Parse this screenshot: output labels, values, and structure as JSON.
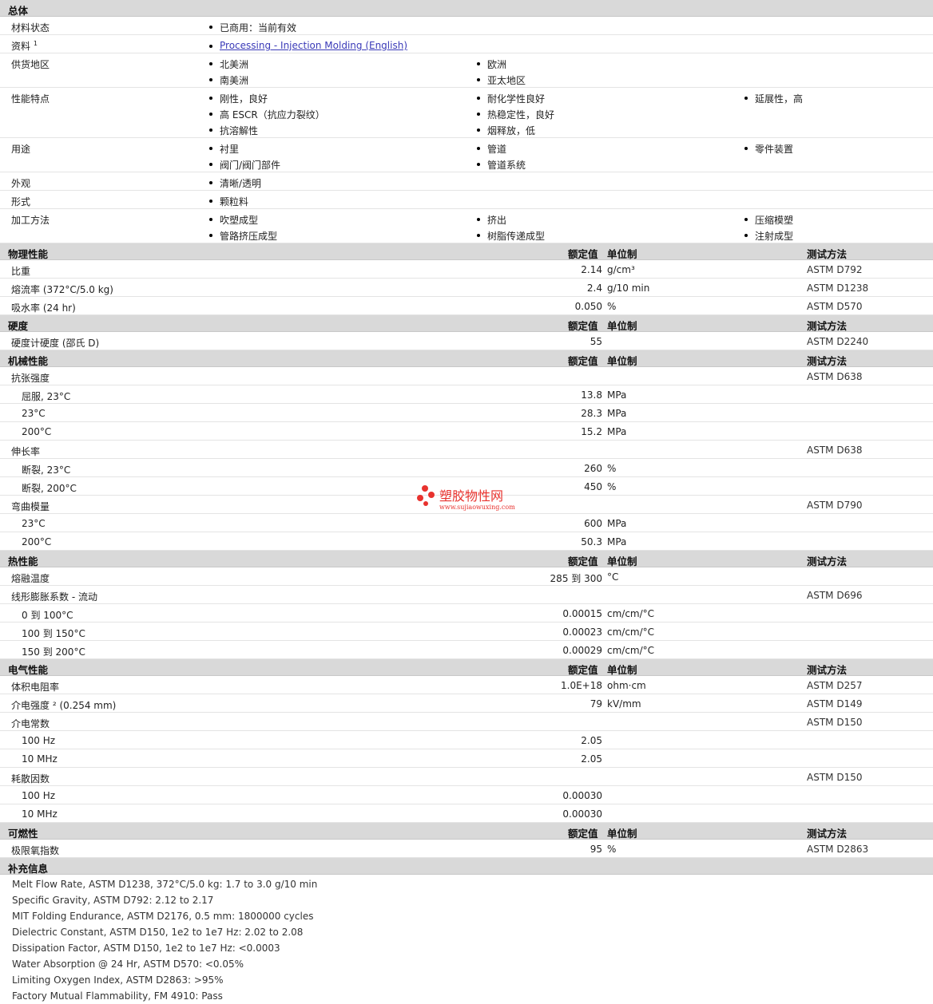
{
  "general": {
    "title": "总体",
    "status_label": "材料状态",
    "status_value": "已商用：当前有效",
    "docs_label": "资料",
    "docs_sup": "1",
    "docs_link": "Processing - Injection Molding (English)",
    "regions_label": "供货地区",
    "regions": [
      "北美洲",
      "欧洲",
      "南美洲",
      "亚太地区"
    ],
    "features_label": "性能特点",
    "features": [
      "刚性，良好",
      "耐化学性良好",
      "延展性，高",
      "高 ESCR（抗应力裂纹）",
      "热稳定性，良好",
      "抗溶解性",
      "烟释放，低"
    ],
    "uses_label": "用途",
    "uses": [
      "衬里",
      "管道",
      "零件装置",
      "阀门/阀门部件",
      "管道系统"
    ],
    "appearance_label": "外观",
    "appearance": "清晰/透明",
    "form_label": "形式",
    "form": "颗粒料",
    "process_label": "加工方法",
    "process": [
      "吹塑成型",
      "挤出",
      "压缩模塑",
      "管路挤压成型",
      "树脂传递成型",
      "注射成型"
    ]
  },
  "headers": {
    "value": "额定值",
    "unit": "单位制",
    "method": "测试方法"
  },
  "sections": [
    {
      "title": "物理性能",
      "rows": [
        {
          "label": "比重",
          "value": "2.14",
          "unit": "g/cm³",
          "method": "ASTM D792"
        },
        {
          "label": "熔流率 (372°C/5.0 kg)",
          "value": "2.4",
          "unit": "g/10 min",
          "method": "ASTM D1238"
        },
        {
          "label": "吸水率 (24 hr)",
          "value": "0.050",
          "unit": "%",
          "method": "ASTM D570"
        }
      ]
    },
    {
      "title": "硬度",
      "rows": [
        {
          "label": "硬度计硬度 (邵氏 D)",
          "value": "55",
          "unit": "",
          "method": "ASTM D2240"
        }
      ]
    },
    {
      "title": "机械性能",
      "rows": [
        {
          "label": "抗张强度",
          "value": "",
          "unit": "",
          "method": "ASTM D638"
        },
        {
          "label": "屈服, 23°C",
          "value": "13.8",
          "unit": "MPa",
          "method": "",
          "sub": true
        },
        {
          "label": "23°C",
          "value": "28.3",
          "unit": "MPa",
          "method": "",
          "sub": true
        },
        {
          "label": "200°C",
          "value": "15.2",
          "unit": "MPa",
          "method": "",
          "sub": true
        },
        {
          "label": "伸长率",
          "value": "",
          "unit": "",
          "method": "ASTM D638"
        },
        {
          "label": "断裂, 23°C",
          "value": "260",
          "unit": "%",
          "method": "",
          "sub": true
        },
        {
          "label": "断裂, 200°C",
          "value": "450",
          "unit": "%",
          "method": "",
          "sub": true
        },
        {
          "label": "弯曲模量",
          "value": "",
          "unit": "",
          "method": "ASTM D790"
        },
        {
          "label": "23°C",
          "value": "600",
          "unit": "MPa",
          "method": "",
          "sub": true
        },
        {
          "label": "200°C",
          "value": "50.3",
          "unit": "MPa",
          "method": "",
          "sub": true
        }
      ]
    },
    {
      "title": "热性能",
      "rows": [
        {
          "label": "熔融温度",
          "value": "285 到 300",
          "unit": "°C",
          "method": ""
        },
        {
          "label": "线形膨胀系数 - 流动",
          "value": "",
          "unit": "",
          "method": "ASTM D696"
        },
        {
          "label": "0 到 100°C",
          "value": "0.00015",
          "unit": "cm/cm/°C",
          "method": "",
          "sub": true
        },
        {
          "label": "100 到 150°C",
          "value": "0.00023",
          "unit": "cm/cm/°C",
          "method": "",
          "sub": true
        },
        {
          "label": "150 到 200°C",
          "value": "0.00029",
          "unit": "cm/cm/°C",
          "method": "",
          "sub": true
        }
      ]
    },
    {
      "title": "电气性能",
      "rows": [
        {
          "label": "体积电阻率",
          "value": "1.0E+18",
          "unit": "ohm·cm",
          "method": "ASTM D257"
        },
        {
          "label": "介电强度 ² (0.254 mm)",
          "value": "79",
          "unit": "kV/mm",
          "method": "ASTM D149"
        },
        {
          "label": "介电常数",
          "value": "",
          "unit": "",
          "method": "ASTM D150"
        },
        {
          "label": "100 Hz",
          "value": "2.05",
          "unit": "",
          "method": "",
          "sub": true
        },
        {
          "label": "10 MHz",
          "value": "2.05",
          "unit": "",
          "method": "",
          "sub": true
        },
        {
          "label": "耗散因数",
          "value": "",
          "unit": "",
          "method": "ASTM D150"
        },
        {
          "label": "100 Hz",
          "value": "0.00030",
          "unit": "",
          "method": "",
          "sub": true
        },
        {
          "label": "10 MHz",
          "value": "0.00030",
          "unit": "",
          "method": "",
          "sub": true
        }
      ]
    },
    {
      "title": "可燃性",
      "rows": [
        {
          "label": "极限氧指数",
          "value": "95",
          "unit": "%",
          "method": "ASTM D2863"
        }
      ]
    }
  ],
  "notes": {
    "title": "补充信息",
    "items": [
      "Melt Flow Rate, ASTM D1238, 372°C/5.0 kg: 1.7 to 3.0 g/10 min",
      "Specific Gravity, ASTM D792: 2.12 to 2.17",
      "MIT Folding Endurance, ASTM D2176, 0.5 mm: 1800000 cycles",
      "Dielectric Constant, ASTM D150, 1e2 to 1e7 Hz: 2.02 to 2.08",
      "Dissipation Factor, ASTM D150, 1e2 to 1e7 Hz: <0.0003",
      "Water Absorption @ 24 Hr, ASTM D570: <0.05%",
      "Limiting Oxygen Index, ASTM D2863: >95%",
      "Factory Mutual Flammability, FM 4910: Pass"
    ]
  },
  "watermark": {
    "title": "塑胶物性网",
    "url": "www.sujiaowuxing.com",
    "color": "#e8322e"
  }
}
